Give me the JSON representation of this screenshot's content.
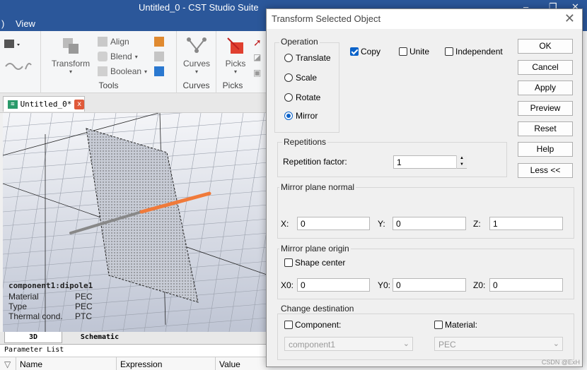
{
  "window": {
    "title": "Untitled_0 - CST Studio Suite",
    "minimize_glyph": "–",
    "restore_glyph": "❐",
    "close_glyph": "✕"
  },
  "menu": {
    "items": [
      "View"
    ]
  },
  "ribbon": {
    "transform_label": "Transform",
    "align_label": "Align",
    "blend_label": "Blend",
    "boolean_label": "Boolean",
    "tools_group": "Tools",
    "curves_label": "Curves",
    "curves_group": "Curves",
    "picks_label": "Picks",
    "picks_group": "Picks"
  },
  "document_tab": {
    "label": "Untitled_0*",
    "close_glyph": "x"
  },
  "viewport": {
    "component": "component1:dipole1",
    "properties": [
      {
        "key": "Material",
        "value": "PEC"
      },
      {
        "key": "Type",
        "value": "PEC"
      },
      {
        "key": "Thermal cond.",
        "value": "PTC"
      }
    ]
  },
  "view_tabs": {
    "tab_3d": "3D",
    "tab_schematic": "Schematic"
  },
  "parameter_list": {
    "title": "Parameter List",
    "columns": [
      "Name",
      "Expression",
      "Value"
    ]
  },
  "dialog": {
    "title": "Transform Selected Object",
    "operation": {
      "title": "Operation",
      "options": [
        "Translate",
        "Scale",
        "Rotate",
        "Mirror"
      ],
      "selected": "Mirror"
    },
    "copy_label": "Copy",
    "copy_checked": true,
    "unite_label": "Unite",
    "unite_checked": false,
    "independent_label": "Independent",
    "independent_checked": false,
    "buttons": {
      "ok": "OK",
      "cancel": "Cancel",
      "apply": "Apply",
      "preview": "Preview",
      "reset": "Reset",
      "help": "Help",
      "less": "Less <<"
    },
    "repetitions": {
      "title": "Repetitions",
      "label": "Repetition factor:",
      "value": "1"
    },
    "mirror_normal": {
      "title": "Mirror plane normal",
      "x_label": "X:",
      "x_value": "0",
      "y_label": "Y:",
      "y_value": "0",
      "z_label": "Z:",
      "z_value": "1"
    },
    "mirror_origin": {
      "title": "Mirror plane origin",
      "shape_center_label": "Shape center",
      "shape_center_checked": false,
      "x0_label": "X0:",
      "x0_value": "0",
      "y0_label": "Y0:",
      "y0_value": "0",
      "z0_label": "Z0:",
      "z0_value": "0"
    },
    "change_destination": {
      "title": "Change destination",
      "component_label": "Component:",
      "component_checked": false,
      "component_value": "component1",
      "material_label": "Material:",
      "material_checked": false,
      "material_value": "PEC"
    }
  },
  "watermark": "CSDN @ExH",
  "colors": {
    "accent": "#0a62c9",
    "titlebar": "#2b579a",
    "dipole_orange": "#f07a3a"
  }
}
